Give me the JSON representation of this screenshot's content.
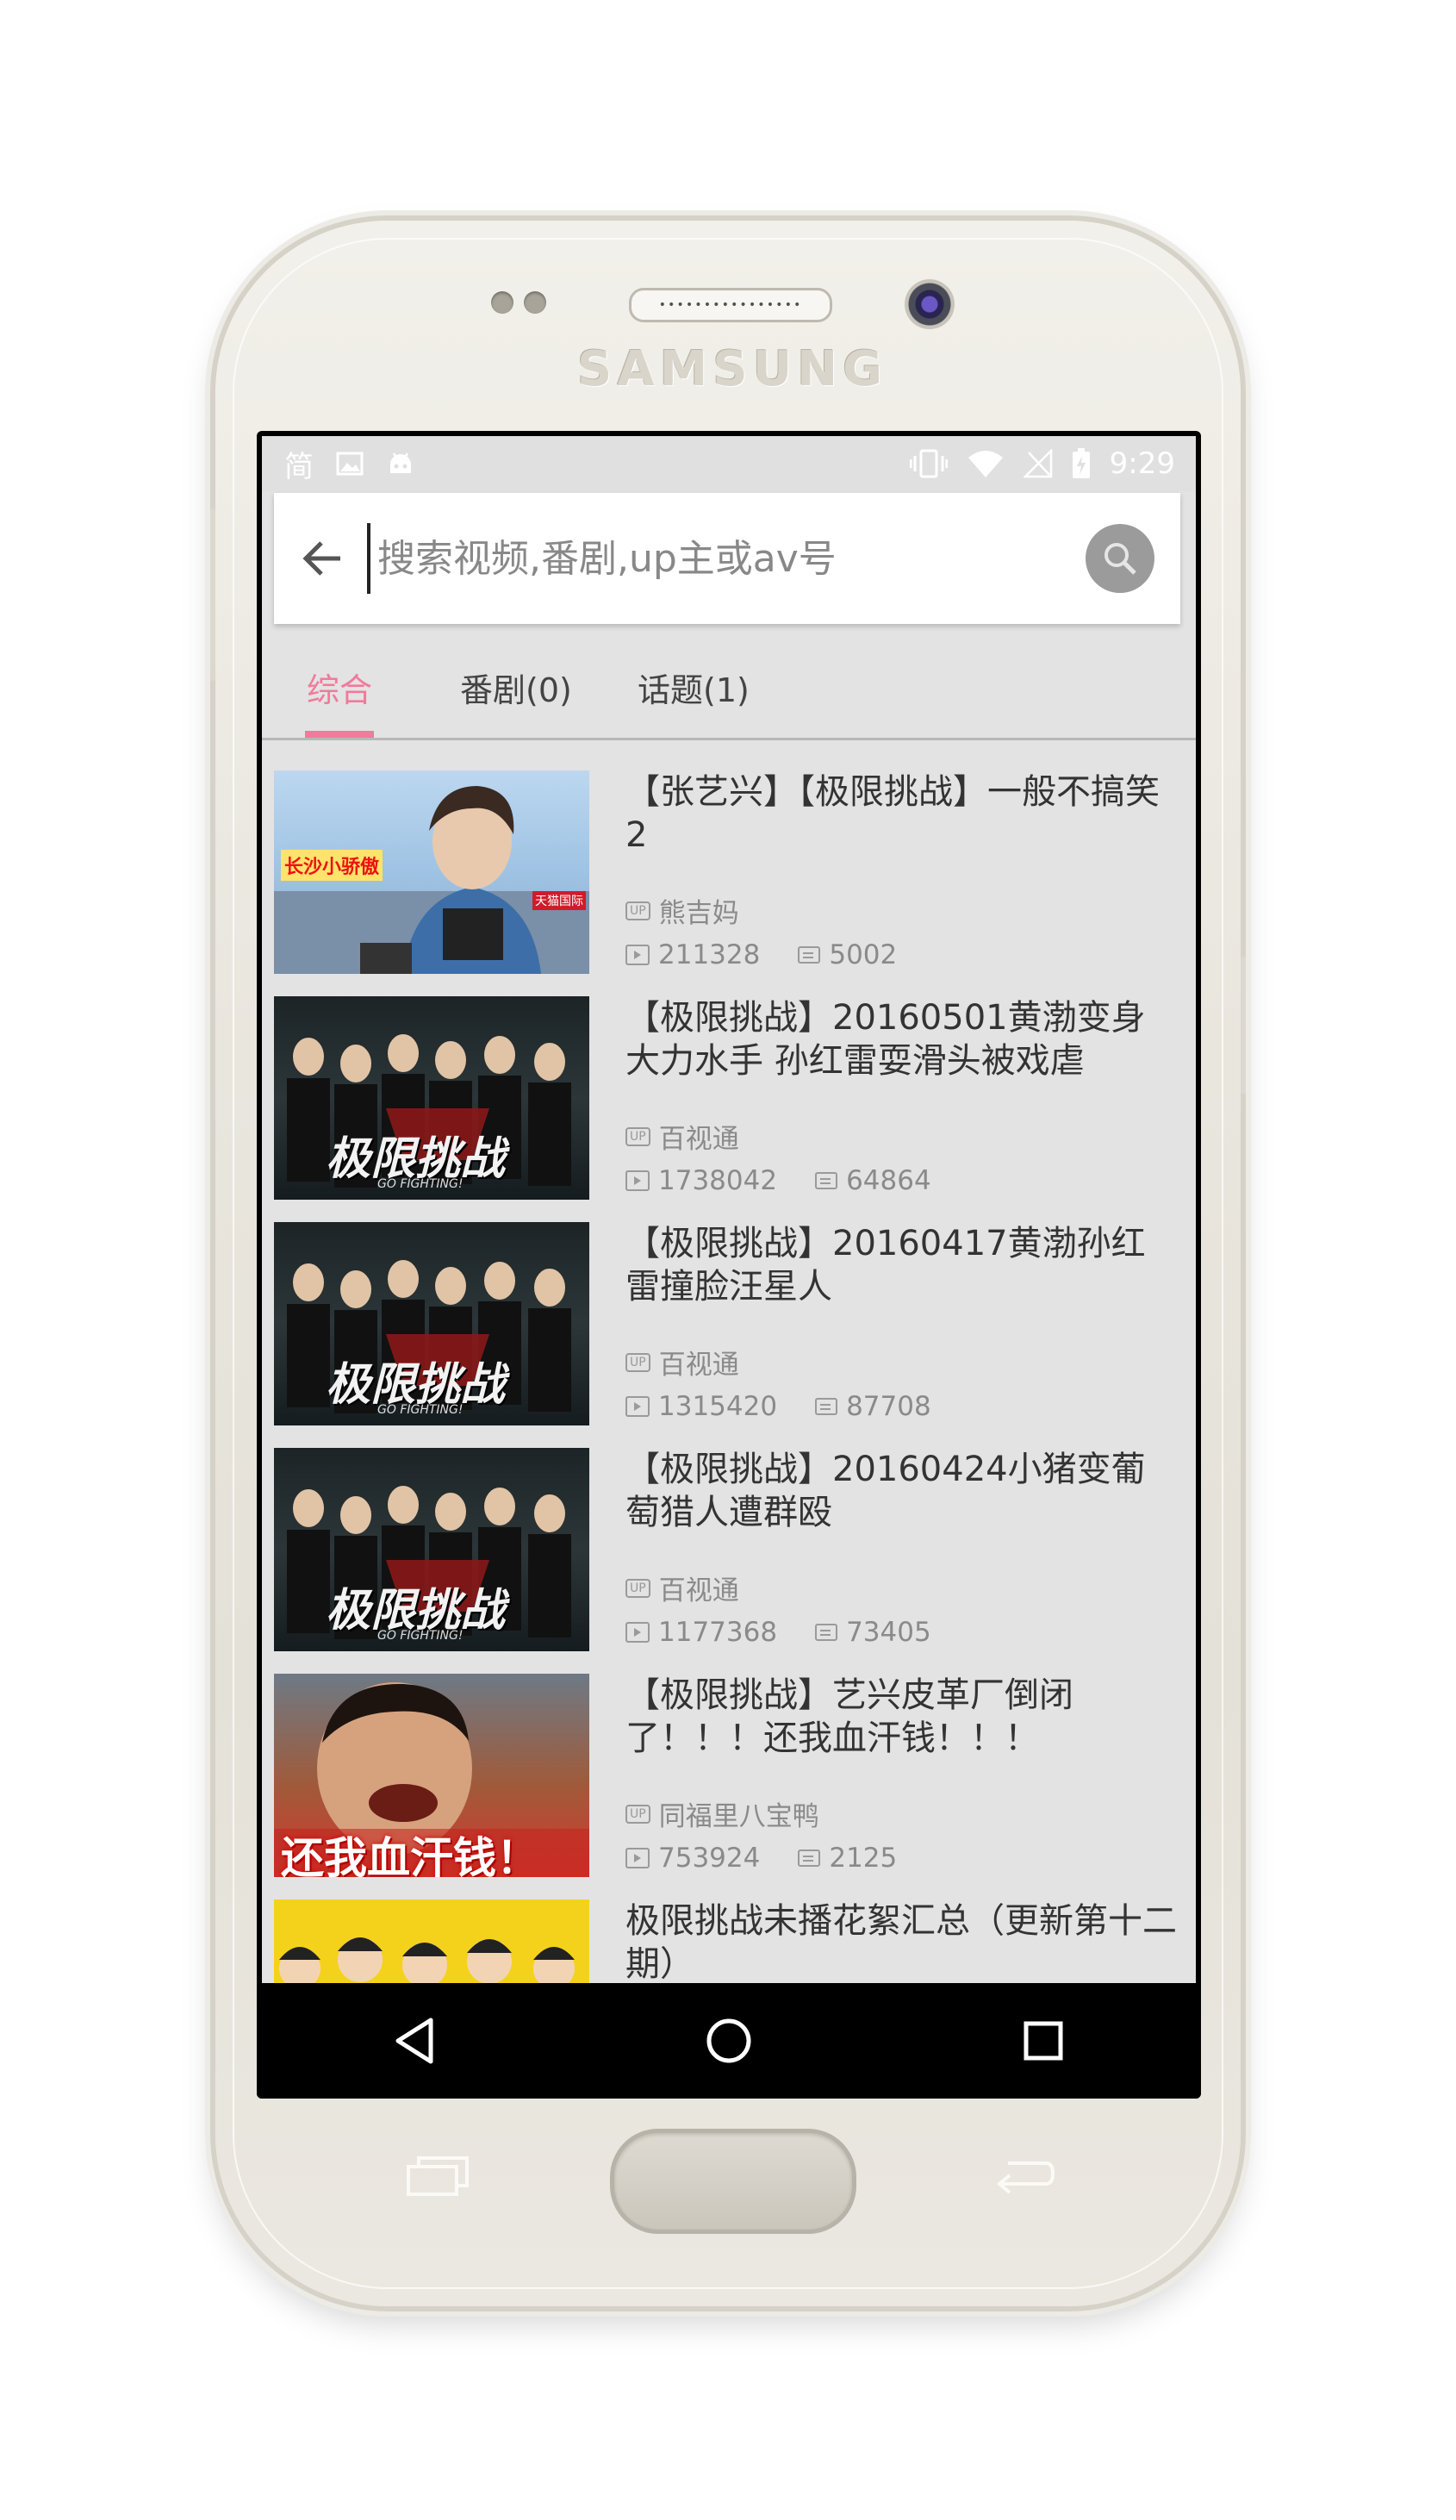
{
  "device": {
    "brand": "SAMSUNG",
    "speaker_grille": "••••••••••••••••"
  },
  "status_bar": {
    "ime_indicator": "简",
    "time": "9:29",
    "icons": [
      "image-icon",
      "android-icon",
      "vibrate-icon",
      "wifi-icon",
      "no-signal-icon",
      "battery-charging-icon"
    ]
  },
  "search": {
    "placeholder": "搜索视频,番剧,up主或av号",
    "value": ""
  },
  "tabs": [
    {
      "label": "综合",
      "active": true
    },
    {
      "label": "番剧(0)",
      "active": false
    },
    {
      "label": "话题(1)",
      "active": false
    }
  ],
  "results": [
    {
      "title": "【张艺兴】【极限挑战】一般不搞笑2",
      "uploader": "熊吉妈",
      "plays": "211328",
      "danmaku": "5002",
      "thumb_text": "长沙小骄傲",
      "thumb_tag": "天猫国际"
    },
    {
      "title": "【极限挑战】20160501黄渤变身大力水手 孙红雷耍滑头被戏虐",
      "uploader": "百视通",
      "plays": "1738042",
      "danmaku": "64864",
      "thumb_text": "极限挑战",
      "thumb_sub": "GO FIGHTING!"
    },
    {
      "title": "【极限挑战】20160417黄渤孙红雷撞脸汪星人",
      "uploader": "百视通",
      "plays": "1315420",
      "danmaku": "87708",
      "thumb_text": "极限挑战",
      "thumb_sub": "GO FIGHTING!"
    },
    {
      "title": "【极限挑战】20160424小猪变葡萄猎人遭群殴",
      "uploader": "百视通",
      "plays": "1177368",
      "danmaku": "73405",
      "thumb_text": "极限挑战",
      "thumb_sub": "GO FIGHTING!"
    },
    {
      "title": "【极限挑战】艺兴皮革厂倒闭了！！！还我血汗钱！！！",
      "uploader": "同福里八宝鸭",
      "plays": "753924",
      "danmaku": "2125",
      "thumb_text": "还我血汗钱！"
    },
    {
      "title": "极限挑战未播花絮汇总（更新第十二期）"
    }
  ],
  "up_badge": "UP",
  "colors": {
    "accent": "#f07b9b",
    "content_bg": "#e3e3e3",
    "text_primary": "#333333",
    "text_secondary": "#8a8a8a"
  }
}
